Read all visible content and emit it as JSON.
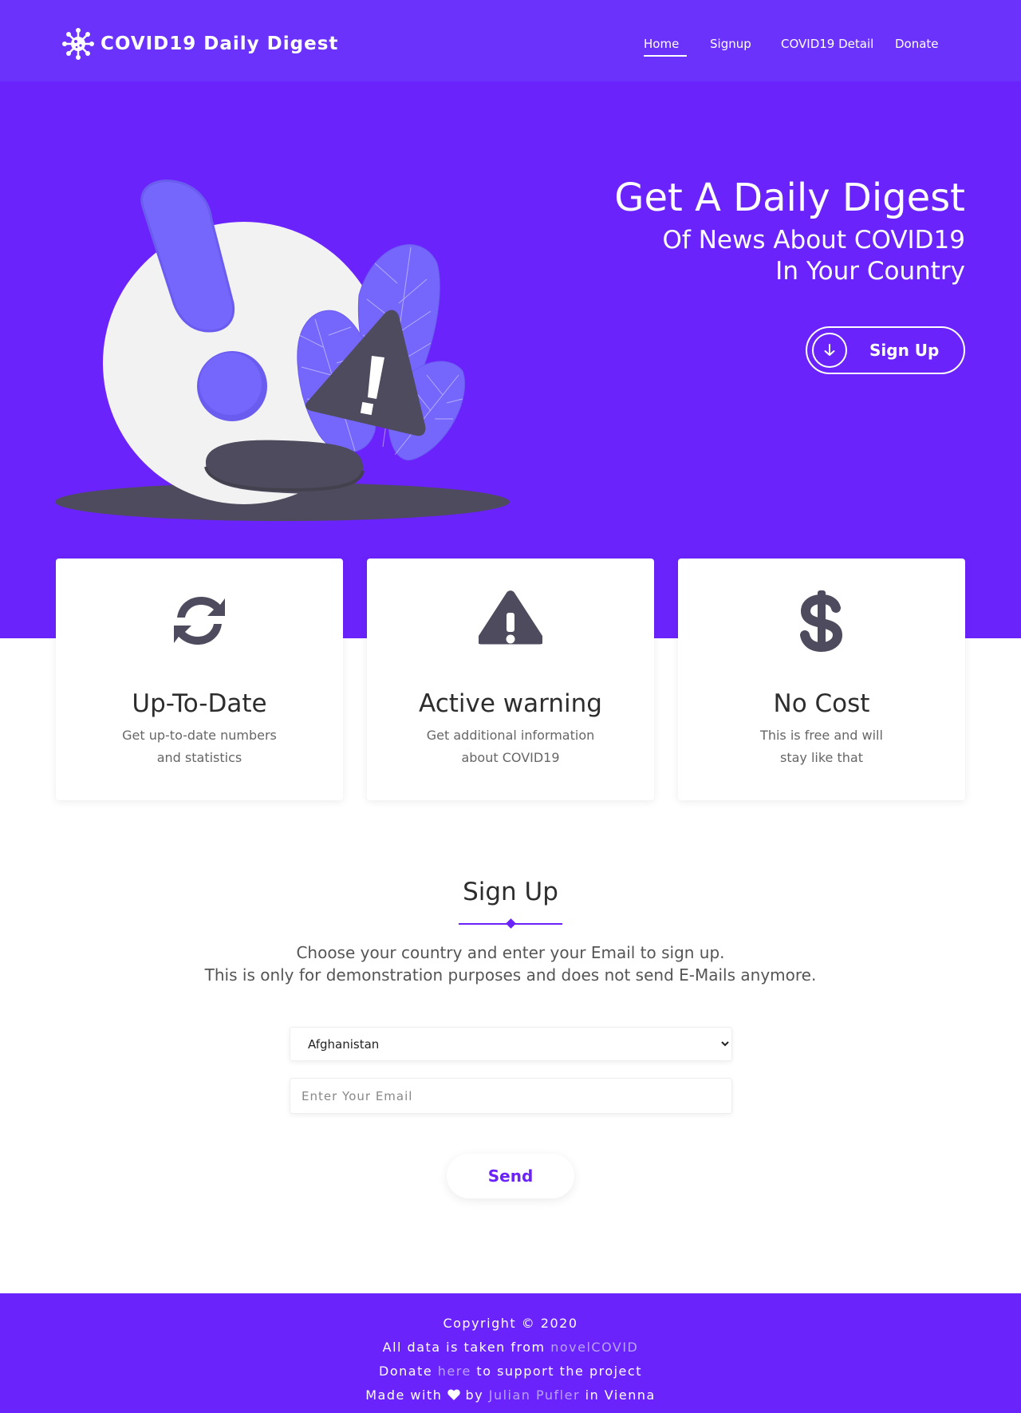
{
  "nav": {
    "brand": "COVID19 Daily Digest",
    "brand_icon": "virus-icon",
    "links": [
      {
        "label": "Home",
        "active": true
      },
      {
        "label": "Signup",
        "active": false
      },
      {
        "label": "COVID19 Detail",
        "active": false
      },
      {
        "label": "Donate",
        "active": false
      }
    ]
  },
  "hero": {
    "title": "Get A Daily Digest",
    "subtitle_line1": "Of News About COVID19",
    "subtitle_line2": "In Your Country",
    "cta_label": "Sign Up",
    "cta_icon": "arrow-down-icon"
  },
  "features": [
    {
      "icon": "refresh-icon",
      "title": "Up-To-Date",
      "desc_line1": "Get up-to-date numbers",
      "desc_line2": "and statistics"
    },
    {
      "icon": "warning-icon",
      "title": "Active warning",
      "desc_line1": "Get additional information",
      "desc_line2": "about COVID19"
    },
    {
      "icon": "dollar-icon",
      "title": "No Cost",
      "desc_line1": "This is free and will",
      "desc_line2": "stay like that"
    }
  ],
  "signup": {
    "title": "Sign Up",
    "text_line1": "Choose your country and enter your Email to sign up.",
    "text_line2": "This is only for demonstration purposes and does not send E-Mails anymore.",
    "country_selected": "Afghanistan",
    "email_placeholder": "Enter Your Email",
    "send_label": "Send"
  },
  "footer": {
    "copyright": "Copyright © 2020",
    "data_prefix": "All data is taken from ",
    "data_link": "novelCOVID",
    "donate_prefix": "Donate ",
    "donate_link": "here",
    "donate_suffix": " to support the project",
    "made_prefix": "Made with ",
    "made_by": " by ",
    "author_link": "Julian Pufler",
    "made_suffix": " in Vienna"
  },
  "colors": {
    "primary": "#6b23fc",
    "nav_bg": "#6a32fa",
    "illustration_accent": "#7667fc",
    "illustration_dark": "#4e4b5e",
    "link_light": "#b9a2ff"
  }
}
